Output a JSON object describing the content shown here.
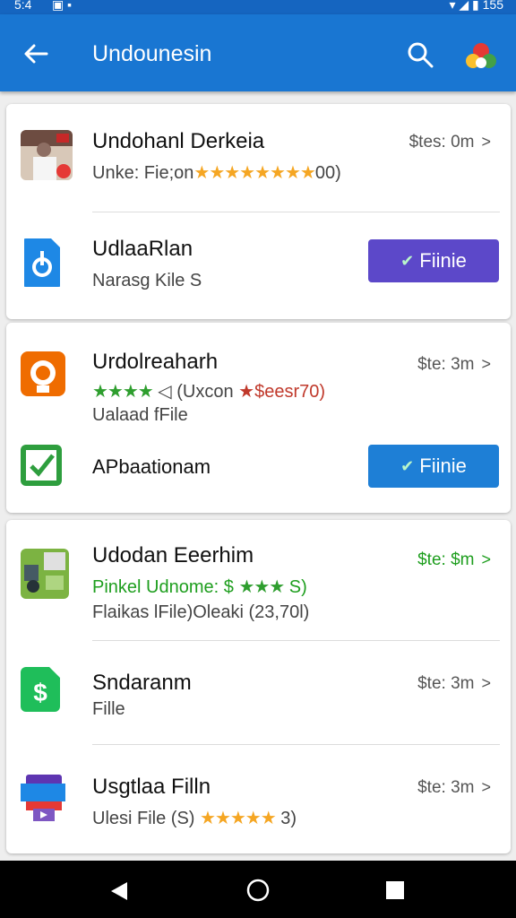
{
  "status": {
    "time": "5:4",
    "right": "155"
  },
  "appbar": {
    "title": "Undounesin"
  },
  "items": [
    {
      "name": "Undohanl Derkeia",
      "sub_prefix": "Unke: Fie;on",
      "stars": "★★★★★★★★",
      "sub_suffix": "00)",
      "meta": "$tes: 0m"
    },
    {
      "name": "UdlaaRlan",
      "sub": "Narasg Kile S",
      "button": "Fiinie"
    },
    {
      "name": "Urdolreaharh",
      "stars": "★★★★",
      "sub_mid": "◁ (Uxcon",
      "sub_red": "★$eesr70)",
      "sub2": "Ualaad fFile",
      "meta": "$te: 3m"
    },
    {
      "name": "APbaationam",
      "button": "Fiinie"
    },
    {
      "name": "Udodan Eeerhim",
      "sub_green": "Pinkel Udnome: $",
      "stars": "★★★",
      "sub_green2": "S)",
      "sub2": "Flaikas lFile)Oleaki (23,70l)",
      "meta": "$te: $m"
    },
    {
      "name": "Sndaranm",
      "sub": "Fille",
      "meta": "$te: 3m"
    },
    {
      "name": "Usgtlaa Filln",
      "sub_prefix": "Ulesi File (S)",
      "stars": "★★★★★",
      "sub_suffix": "3)",
      "meta": "$te: 3m"
    }
  ],
  "colors": {
    "appbar": "#1976d2",
    "btn_purple": "#5c48c9",
    "btn_blue": "#1e7fd6"
  }
}
